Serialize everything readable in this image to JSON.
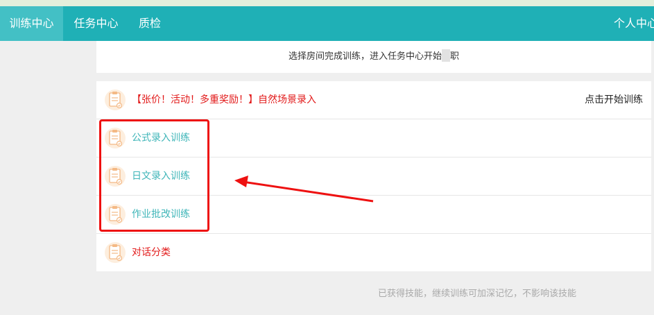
{
  "nav": {
    "items": [
      {
        "label": "训练中心",
        "active": true
      },
      {
        "label": "任务中心",
        "active": false
      },
      {
        "label": "质检",
        "active": false
      }
    ],
    "profile_label": "个人中心"
  },
  "notice": {
    "text_before": "选择房间完成训练，进入",
    "link_text": "任务中心",
    "text_after": "开始",
    "text_tail": "职"
  },
  "training_list": [
    {
      "label": "【张价！活动！多重奖励！】自然场景录入",
      "color": "red",
      "action": "点击开始训练"
    },
    {
      "label": "公式录入训练",
      "color": "teal",
      "action": ""
    },
    {
      "label": "日文录入训练",
      "color": "teal",
      "action": ""
    },
    {
      "label": "作业批改训练",
      "color": "teal",
      "action": ""
    },
    {
      "label": "对话分类",
      "color": "red",
      "action": ""
    }
  ],
  "footer_note": "已获得技能，继续训练可加深记忆，不影响该技能",
  "colors": {
    "navbar": "#1fb0b6",
    "nav_active": "#43c0c5",
    "red_text": "#e21a1a",
    "teal_text": "#3eb5b8",
    "annotation": "#ee1111",
    "icon_bg": "#fdeede",
    "icon_stroke": "#f4b985"
  },
  "icons": {
    "row_icon": "clipboard-icon"
  }
}
